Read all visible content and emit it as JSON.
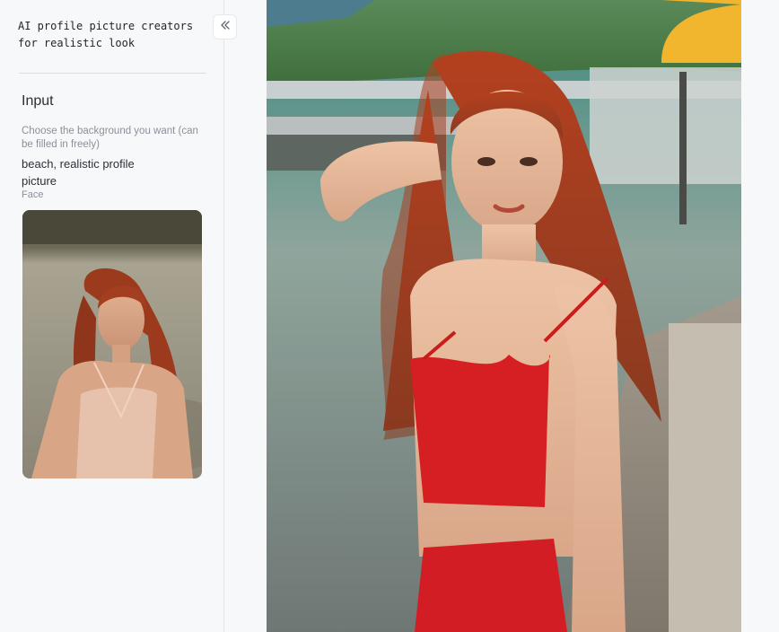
{
  "app": {
    "title": "AI profile picture creators\nfor realistic look"
  },
  "icons": {
    "collapse": "double-chevron-left-icon"
  },
  "input": {
    "section_title": "Input",
    "background_hint": "Choose the background you want (can be filled in freely)",
    "background_value": "beach, realistic profile picture",
    "face_label": "Face"
  }
}
